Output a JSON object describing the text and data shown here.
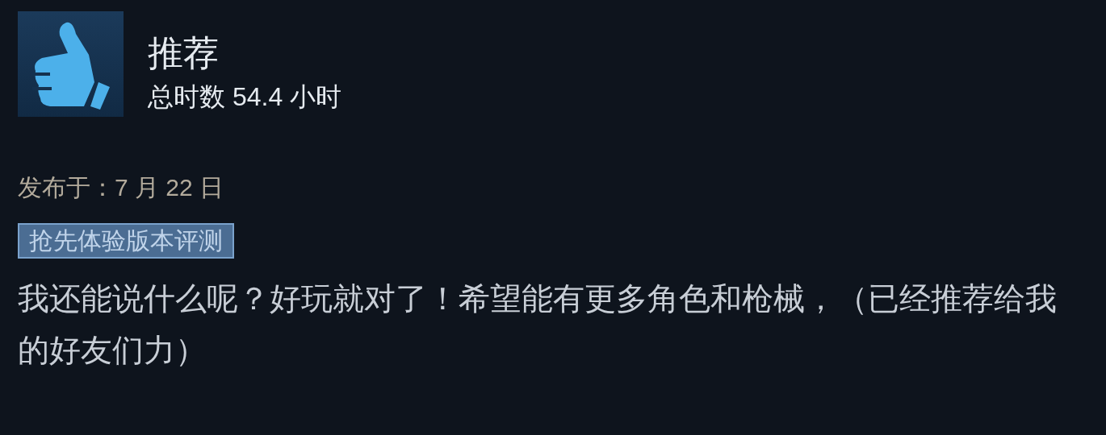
{
  "review": {
    "verdict": "推荐",
    "playtime": "总时数 54.4 小时",
    "posted": "发布于：7 月 22 日",
    "badge": "抢先体验版本评测",
    "body": "我还能说什么呢？好玩就对了！希望能有更多角色和枪械，（已经推荐给我的好友们力）"
  }
}
